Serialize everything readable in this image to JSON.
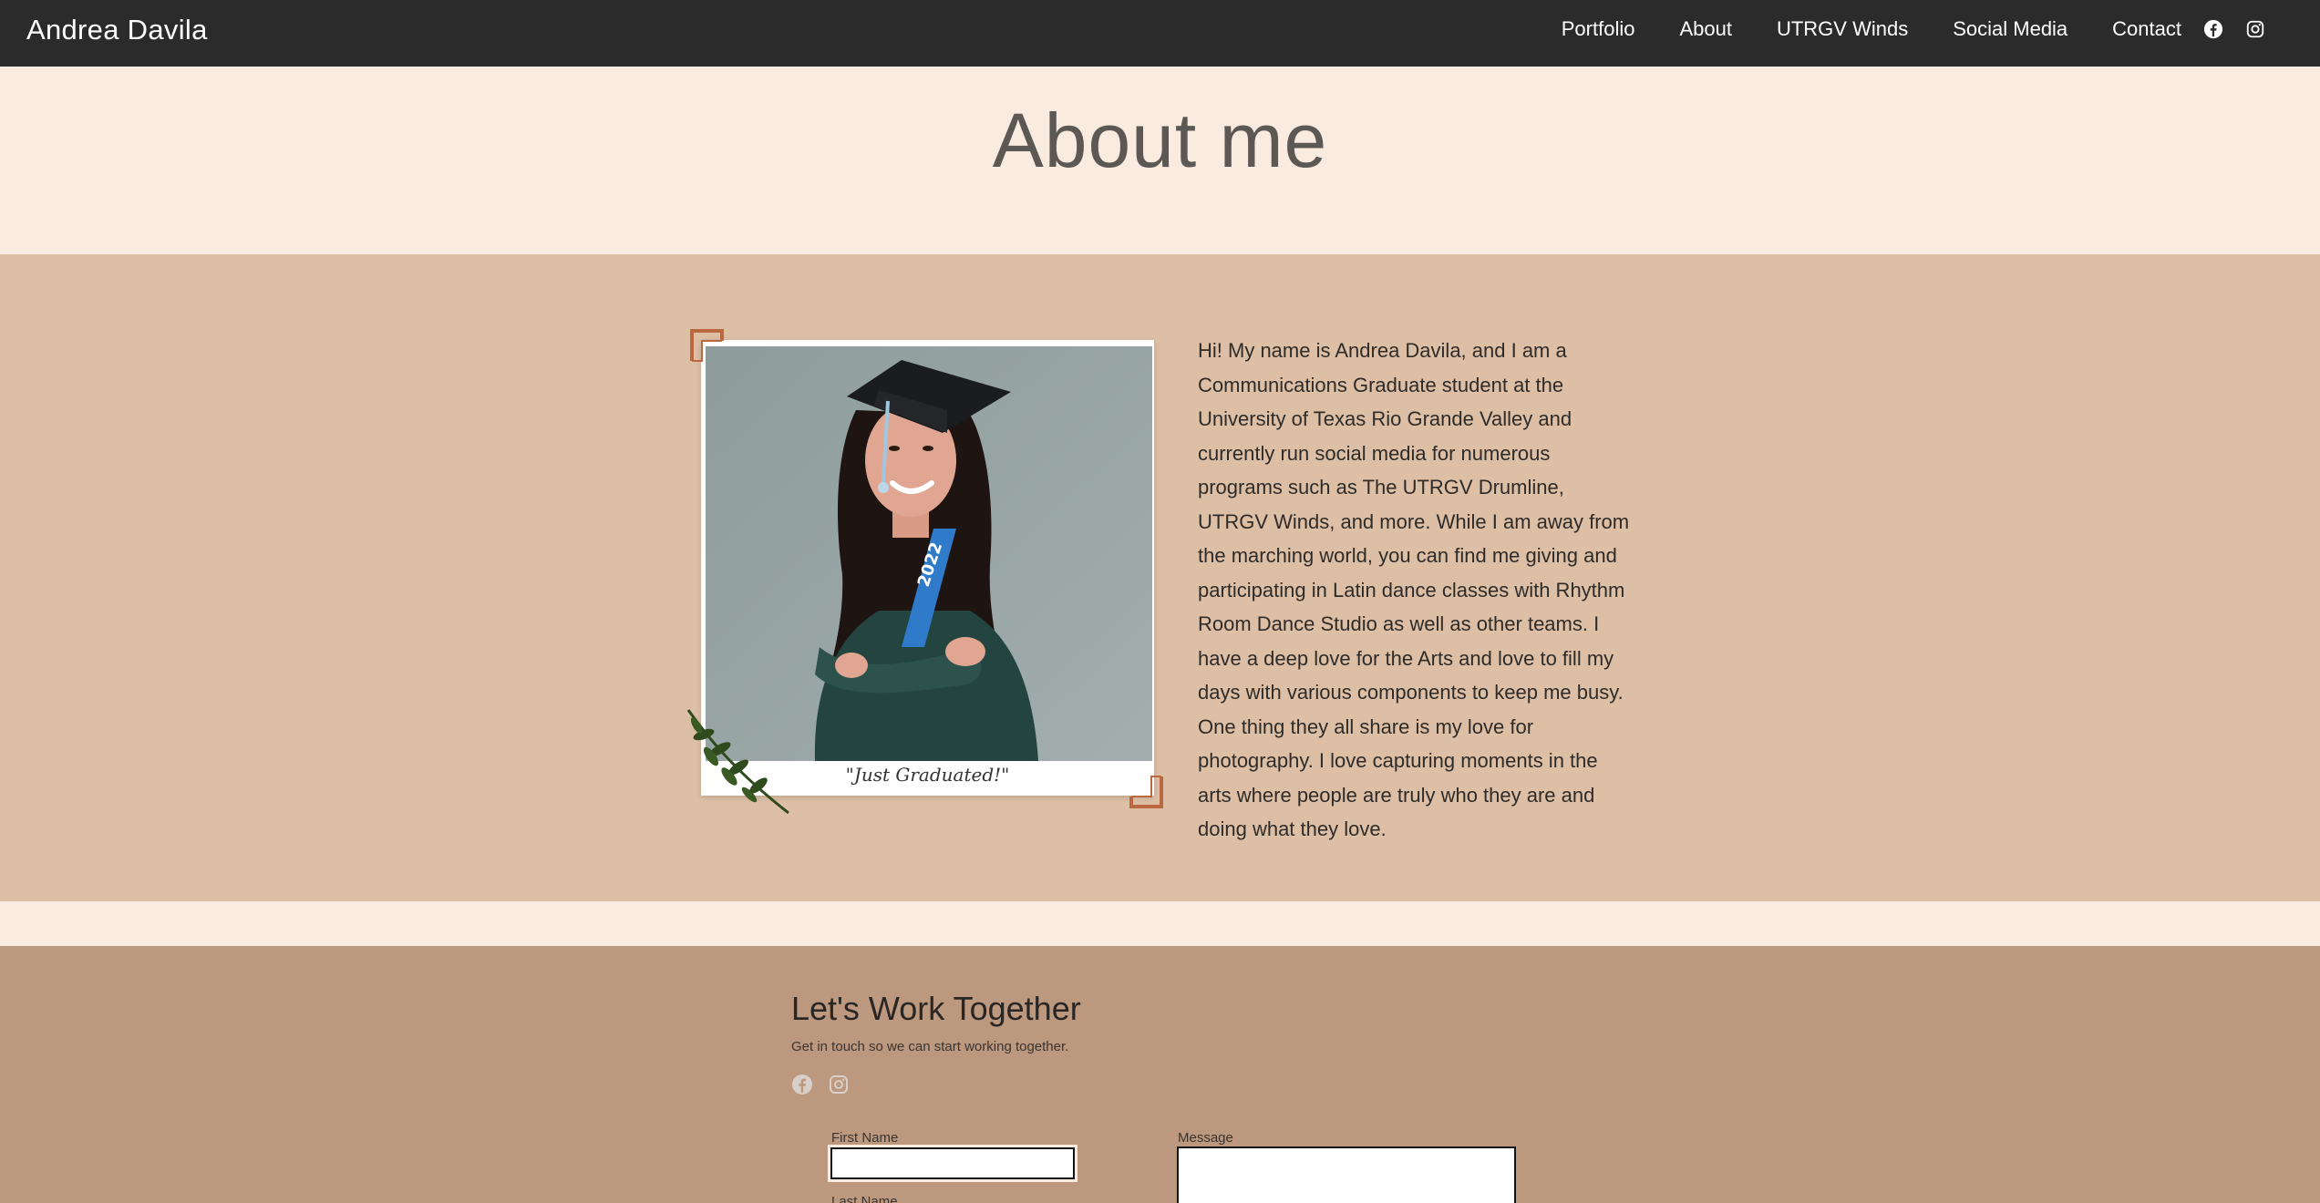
{
  "header": {
    "brand": "Andrea Davila",
    "nav": [
      "Portfolio",
      "About",
      "UTRGV Winds",
      "Social Media",
      "Contact"
    ],
    "icons": [
      "facebook-icon",
      "instagram-icon"
    ]
  },
  "about": {
    "title": "About me",
    "photo_caption": "\"Just Graduated!\"",
    "photo_badge": "2022",
    "bio": "Hi! My name is Andrea Davila, and I am a Communications Graduate student at the University of Texas Rio Grande Valley and currently run social media for numerous programs such as The UTRGV Drumline, UTRGV Winds, and more. While I am away from the marching world, you can find me giving and participating in Latin dance classes with Rhythm Room Dance Studio as well as other teams. I have a deep love for the Arts and love to fill my days with various components to keep me busy. One thing they all share is my love for photography. I love capturing moments in the arts where people are truly who they are and doing what they love."
  },
  "contact": {
    "title": "Let's Work Together",
    "subtitle": "Get in touch so we can start working together.",
    "icons": [
      "facebook-icon",
      "instagram-icon"
    ],
    "first_name_label": "First Name",
    "first_name_value": "",
    "message_label": "Message",
    "message_value": "",
    "last_name_label": "Last Name"
  },
  "colors": {
    "topbar": "#2b2b2b",
    "page_bg": "#faebe0",
    "about_bg": "#ddbfa6",
    "contact_bg": "#bc987f",
    "title_text": "#5c5854",
    "accent_frame": "#b9683f",
    "leaf": "#2f4a1c"
  }
}
